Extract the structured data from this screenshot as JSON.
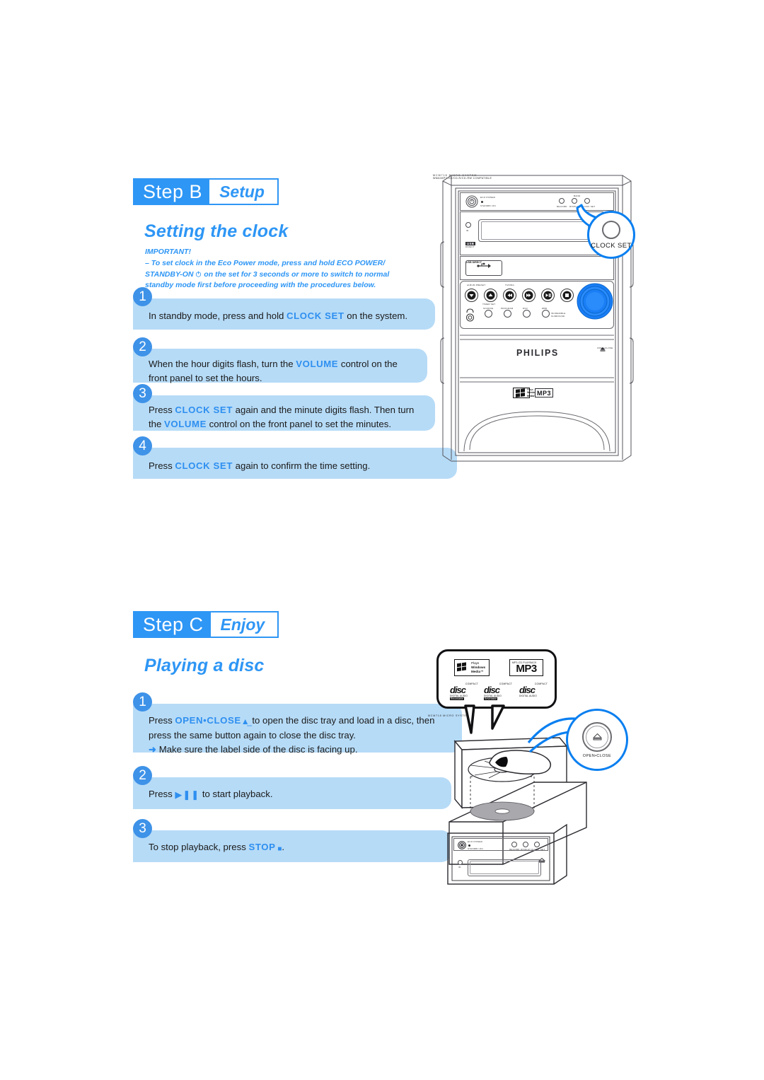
{
  "page": {
    "background": "#ffffff",
    "accent_blue": "#2e96f5",
    "band_blue": "#b6dbf7",
    "num_circle_blue": "#3e92e8"
  },
  "step_b": {
    "chip_step": "Step",
    "chip_letter": "B",
    "chip_tag": "Setup",
    "title": "Setting the clock",
    "important": {
      "heading": "IMPORTANT!",
      "line1": "– To set clock in the Eco Power mode, press and hold ECO POWER/",
      "line2_pre": "STANDBY-ON",
      "line2_icon": "power-standby-icon",
      "line2_post": "on the set for 3 seconds or more to switch to normal",
      "line3": "standby mode first before proceeding with the procedures below."
    },
    "steps": [
      {
        "num": "1",
        "parts": [
          {
            "t": "In standby mode, press and hold ",
            "hl": false
          },
          {
            "t": "CLOCK SET",
            "hl": true
          },
          {
            "t": " on the system.",
            "hl": false
          }
        ]
      },
      {
        "num": "2",
        "parts": [
          {
            "t": "When the hour digits flash, turn the ",
            "hl": false
          },
          {
            "t": "VOLUME",
            "hl": true
          },
          {
            "t": " control on the front panel to set the hours.",
            "hl": false
          }
        ]
      },
      {
        "num": "3",
        "parts": [
          {
            "t": "Press ",
            "hl": false
          },
          {
            "t": "CLOCK SET",
            "hl": true
          },
          {
            "t": " again and the minute digits flash. Then turn the ",
            "hl": false
          },
          {
            "t": "VOLUME",
            "hl": true
          },
          {
            "t": " control on the front panel to set the minutes.",
            "hl": false
          }
        ]
      },
      {
        "num": "4",
        "parts": [
          {
            "t": "Press ",
            "hl": false
          },
          {
            "t": "CLOCK SET",
            "hl": true
          },
          {
            "t": " again to confirm the time setting.",
            "hl": false
          }
        ]
      }
    ]
  },
  "step_c": {
    "chip_step": "Step",
    "chip_letter": "C",
    "chip_tag": "Enjoy",
    "title": "Playing a disc",
    "steps": [
      {
        "num": "1",
        "line1_pre": "Press ",
        "line1_hl": "OPEN•CLOSE",
        "line1_icon": "eject-icon",
        "line1_post": " to open the disc tray and load in a disc, then press the same button again to close the disc tray.",
        "line2_arrow": "➜",
        "line2": "Make sure the label side of the disc is facing up."
      },
      {
        "num": "2",
        "line1_pre": "Press ",
        "line1_icon": "play-pause-icon",
        "line1_post": " to start playback."
      },
      {
        "num": "3",
        "line1_pre": "To stop playback, press ",
        "line1_hl": "STOP",
        "line1_icon": "stop-icon",
        "line1_post": "."
      }
    ]
  },
  "illustration_b": {
    "name": "philips-micro-system-front",
    "model_label": "MCM718 MICRO SYSTEM",
    "brand": "PHILIPS",
    "eco_power_label": "ECO POWER",
    "standby_label": "STANDBY-ON",
    "ir_label": "IR",
    "usb_badge": "USB",
    "usb_badge_sub": "DIRECT",
    "usb_direct_button": "USB DIRECT",
    "band_label": "BAND",
    "top_buttons": [
      "RECORD",
      "DISPLAY",
      "CLOCK SET"
    ],
    "album_preset_label": "ALBUM PRESET",
    "tuning_label": "TUNING",
    "timer_set_label": "TIMER SET",
    "volume_label": "VOLUME",
    "bottom_buttons": [
      "SOURCE",
      "PROGRAM",
      "DSC",
      "DBB"
    ],
    "surround_label": "INCREDIBLE SURROUND",
    "open_close_side": "OPEN•CLOSE",
    "compat_text": "WMA/MP3-CD/CD-R/CD-RW COMPATIBLE",
    "mp3_logo": "MP3",
    "callout": {
      "label": "CLOCK SET",
      "ring_color": "#0a7ff0"
    }
  },
  "illustration_c": {
    "name": "disc-loading-illustration",
    "bubble_logos": {
      "windows_media": {
        "l1": "Plays",
        "l2": "Windows",
        "l3": "Media™"
      },
      "mp3": {
        "caption": "MP3-CD PLAYBACK",
        "word": "MP3"
      },
      "discs": [
        {
          "top": "COMPACT",
          "word": "disc",
          "bottom": "DIGITAL AUDIO",
          "tag": "Recordable"
        },
        {
          "top": "COMPACT",
          "word": "disc",
          "bottom": "DIGITAL AUDIO",
          "tag": "ReWritable"
        },
        {
          "top": "COMPACT",
          "word": "disc",
          "bottom": "DIGITAL AUDIO",
          "tag": ""
        }
      ]
    },
    "callout": {
      "label": "OPEN•CLOSE",
      "icon": "eject-icon",
      "ring_color": "#0a7ff0"
    },
    "device_model_label": "MCM718 MICRO SYSTEM",
    "device_eco": "ECO POWER",
    "device_standby": "STANDBY-ON",
    "device_buttons": [
      "RECORD",
      "DISPLAY",
      "CLOCK SET"
    ],
    "device_ir": "IR"
  }
}
